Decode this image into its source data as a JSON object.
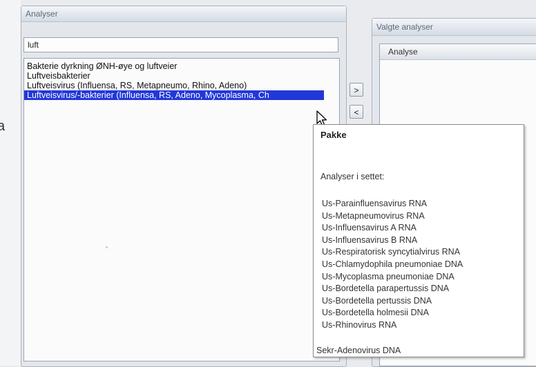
{
  "analyser": {
    "title": "Analyser",
    "search_value": "luft",
    "results": [
      "Bakterie dyrkning ØNH-øye og luftveier",
      "Luftveisbakterier",
      "Luftveisvirus (Influensa, RS, Metapneumo, Rhino, Adeno)",
      "Luftveisvirus/-bakterier (Influensa, RS, Adeno, Mycoplasma, Ch"
    ],
    "selected_index": 3
  },
  "buttons": {
    "add": ">",
    "remove": "<"
  },
  "valgte": {
    "title": "Valgte analyser",
    "column_header": "Analyse"
  },
  "tooltip": {
    "title": "Pakke",
    "subtitle": "Analyser i settet:",
    "items": [
      "Us-Parainfluensavirus RNA",
      "Us-Metapneumovirus RNA",
      "Us-Influensavirus A RNA",
      "Us-Influensavirus B RNA",
      "Us-Respiratorisk syncytialvirus RNA",
      "Us-Chlamydophila pneumoniae DNA",
      "Us-Mycoplasma pneumoniae DNA",
      "Us-Bordetella parapertussis DNA",
      "Us-Bordetella pertussis DNA",
      "Us-Bordetella holmesii DNA",
      "Us-Rhinovirus RNA"
    ],
    "last_item": "Sekr-Adenovirus DNA"
  },
  "edge_glyph": "a"
}
